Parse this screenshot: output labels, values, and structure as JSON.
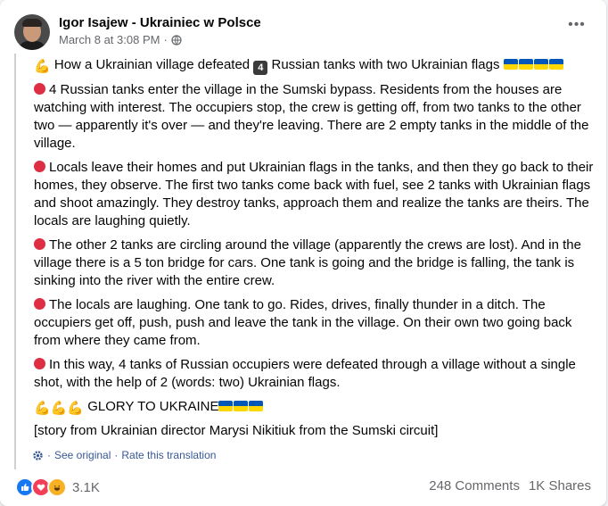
{
  "post": {
    "author": "Igor Isajew - Ukrainiec w Polsce",
    "timestamp": "March 8 at 3:08 PM",
    "separator": "·",
    "privacy_icon": "globe-icon",
    "more_label": "•••"
  },
  "content": {
    "title_emoji": "💪",
    "title_part1": "How a Ukrainian village defeated",
    "title_number": "4",
    "title_part2": "Russian tanks with two Ukrainian flags",
    "paragraphs": [
      "4 Russian tanks enter the village in the Sumski bypass. Residents from the houses are watching with interest. The occupiers stop, the crew is getting off, from two tanks to the other two — apparently it's over — and they're leaving. There are 2 empty tanks in the middle of the village.",
      "Locals leave their homes and put Ukrainian flags in the tanks, and then they go back to their homes, they observe. The first two tanks come back with fuel, see 2 tanks with Ukrainian flags and shoot amazingly. They destroy tanks, approach them and realize the tanks are theirs. The locals are laughing quietly.",
      "The other 2 tanks are circling around the village (apparently the crews are lost). And in the village there is a 5 ton bridge for cars. One tank is going and the bridge is falling, the tank is sinking into the river with the entire crew.",
      "The locals are laughing. One tank to go. Rides, drives, finally thunder in a ditch. The occupiers get off, push, push and leave the tank in the village. On their own two going back from where they came from.",
      "In this way, 4 tanks of Russian occupiers were defeated through a village without a single shot, with the help of 2 (words: two) Ukrainian flags."
    ],
    "glory_emoji": "💪💪💪",
    "glory_text": "GLORY TO UKRAINE",
    "story": "[story from Ukrainian director Marysi Nikitiuk from the Sumski circuit]"
  },
  "translation": {
    "see_original": "See original",
    "dot": "·",
    "rate": "Rate this translation"
  },
  "footer": {
    "reaction_count": "3.1K",
    "comments": "248 Comments",
    "shares": "1K Shares"
  },
  "colors": {
    "brand_blue": "#1877f2",
    "link": "#385898",
    "muted": "#65676b",
    "flag_blue": "#0057b7",
    "flag_yellow": "#ffd700",
    "red_dot": "#dd2e44"
  }
}
